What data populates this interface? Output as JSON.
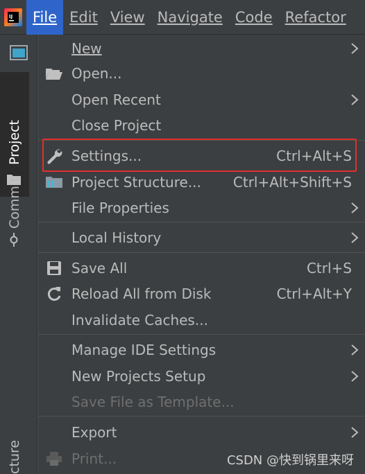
{
  "menubar": {
    "items": [
      {
        "label": "File"
      },
      {
        "label": "Edit"
      },
      {
        "label": "View"
      },
      {
        "label": "Navigate"
      },
      {
        "label": "Code"
      },
      {
        "label": "Refactor"
      }
    ],
    "logo_icon": "intellij-logo-icon"
  },
  "toolstrip": {
    "project_tab": "Project",
    "commit_tab": "Commit",
    "structure_tab": "cture"
  },
  "file_menu": {
    "new": "New",
    "open": "Open...",
    "open_recent": "Open Recent",
    "close_project": "Close Project",
    "settings": "Settings...",
    "settings_shortcut": "Ctrl+Alt+S",
    "project_structure": "Project Structure...",
    "project_structure_shortcut": "Ctrl+Alt+Shift+S",
    "file_properties": "File Properties",
    "local_history": "Local History",
    "save_all": "Save All",
    "save_all_shortcut": "Ctrl+S",
    "reload": "Reload All from Disk",
    "reload_shortcut": "Ctrl+Alt+Y",
    "invalidate": "Invalidate Caches...",
    "manage_ide": "Manage IDE Settings",
    "new_projects_setup": "New Projects Setup",
    "save_template": "Save File as Template...",
    "export": "Export",
    "print": "Print..."
  },
  "watermark": "CSDN @快到锅里来呀",
  "colors": {
    "background": "#3c3f41",
    "selected_menu": "#2f65ca",
    "highlight_border": "#e0302e",
    "text": "#bbbbbb",
    "disabled_text": "#6f6f6f"
  }
}
